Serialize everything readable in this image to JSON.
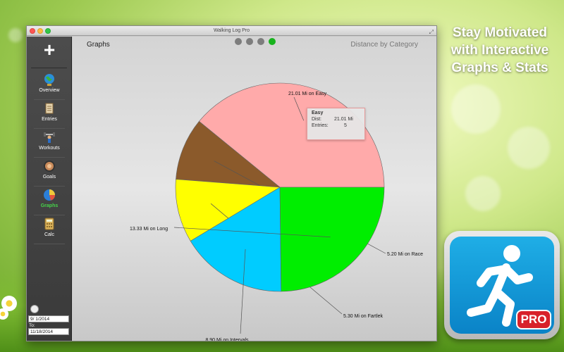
{
  "window": {
    "title": "Walking Log Pro"
  },
  "sidebar": {
    "items": [
      {
        "label": "Overview",
        "icon": "globe-icon"
      },
      {
        "label": "Entries",
        "icon": "entries-icon"
      },
      {
        "label": "Workouts",
        "icon": "workouts-icon"
      },
      {
        "label": "Goals",
        "icon": "goals-icon"
      },
      {
        "label": "Graphs",
        "icon": "pie-chart-icon",
        "active": true
      },
      {
        "label": "Calc",
        "icon": "calculator-icon"
      }
    ],
    "date_from": "9/ 1/2014",
    "to_label": "To:",
    "date_to": "11/18/2014"
  },
  "main": {
    "page_title": "Graphs",
    "graph_title": "Distance by Category",
    "page_indicator": {
      "count": 4,
      "active_index": 3
    }
  },
  "tooltip": {
    "title": "Easy",
    "dist_label": "Dist:",
    "dist_value": "21.01 Mi",
    "entries_label": "Entries:",
    "entries_value": "5"
  },
  "promo": {
    "line1": "Stay Motivated",
    "line2": "with Interactive",
    "line3": "Graphs & Stats"
  },
  "app_icon": {
    "badge": "PRO"
  },
  "chart_data": {
    "type": "pie",
    "title": "Distance by Category",
    "unit": "Mi",
    "slices": [
      {
        "category": "Easy",
        "value": 21.01,
        "label": "21.01 Mi on Easy",
        "color": "#ffaaaa"
      },
      {
        "category": "Race",
        "value": 5.2,
        "label": "5.20 Mi on Race",
        "color": "#8b5a2b"
      },
      {
        "category": "Fartlek",
        "value": 5.3,
        "label": "5.30 Mi on Fartlek",
        "color": "#ffff00"
      },
      {
        "category": "Intervals",
        "value": 8.9,
        "label": "8.90 Mi on Intervals",
        "color": "#00ccff"
      },
      {
        "category": "Long",
        "value": 13.33,
        "label": "13.33 Mi on Long",
        "color": "#00ee00"
      }
    ]
  }
}
